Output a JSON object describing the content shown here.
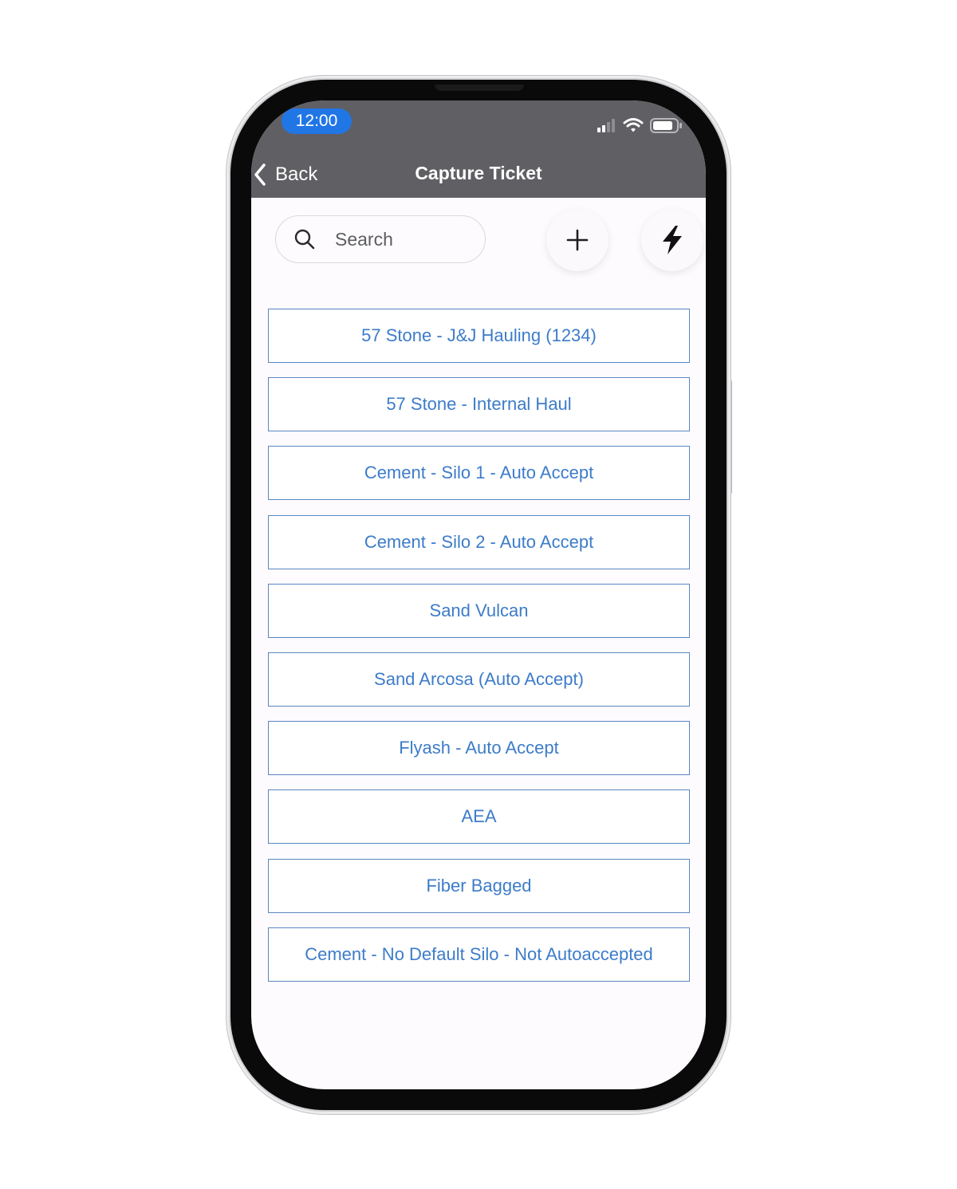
{
  "status_bar": {
    "time": "12:00",
    "icons": [
      "signal-icon",
      "wifi-icon",
      "battery-icon"
    ]
  },
  "header": {
    "back_label": "Back",
    "title": "Capture Ticket"
  },
  "toolbar": {
    "search_placeholder": "Search",
    "add_icon": "plus-icon",
    "quick_icon": "lightning-icon"
  },
  "products": [
    {
      "label": "57 Stone - J&J Hauling (1234)"
    },
    {
      "label": "57 Stone - Internal Haul"
    },
    {
      "label": "Cement - Silo 1 - Auto Accept"
    },
    {
      "label": "Cement - Silo 2 - Auto Accept"
    },
    {
      "label": "Sand Vulcan"
    },
    {
      "label": "Sand Arcosa (Auto Accept)"
    },
    {
      "label": "Flyash - Auto Accept"
    },
    {
      "label": "AEA"
    },
    {
      "label": "Fiber Bagged"
    },
    {
      "label": "Cement - No Default Silo - Not Autoaccepted"
    }
  ],
  "colors": {
    "header_bg": "#605f63",
    "accent": "#2176e6",
    "item_text": "#3d7cc9",
    "item_border": "#5b86c2"
  }
}
